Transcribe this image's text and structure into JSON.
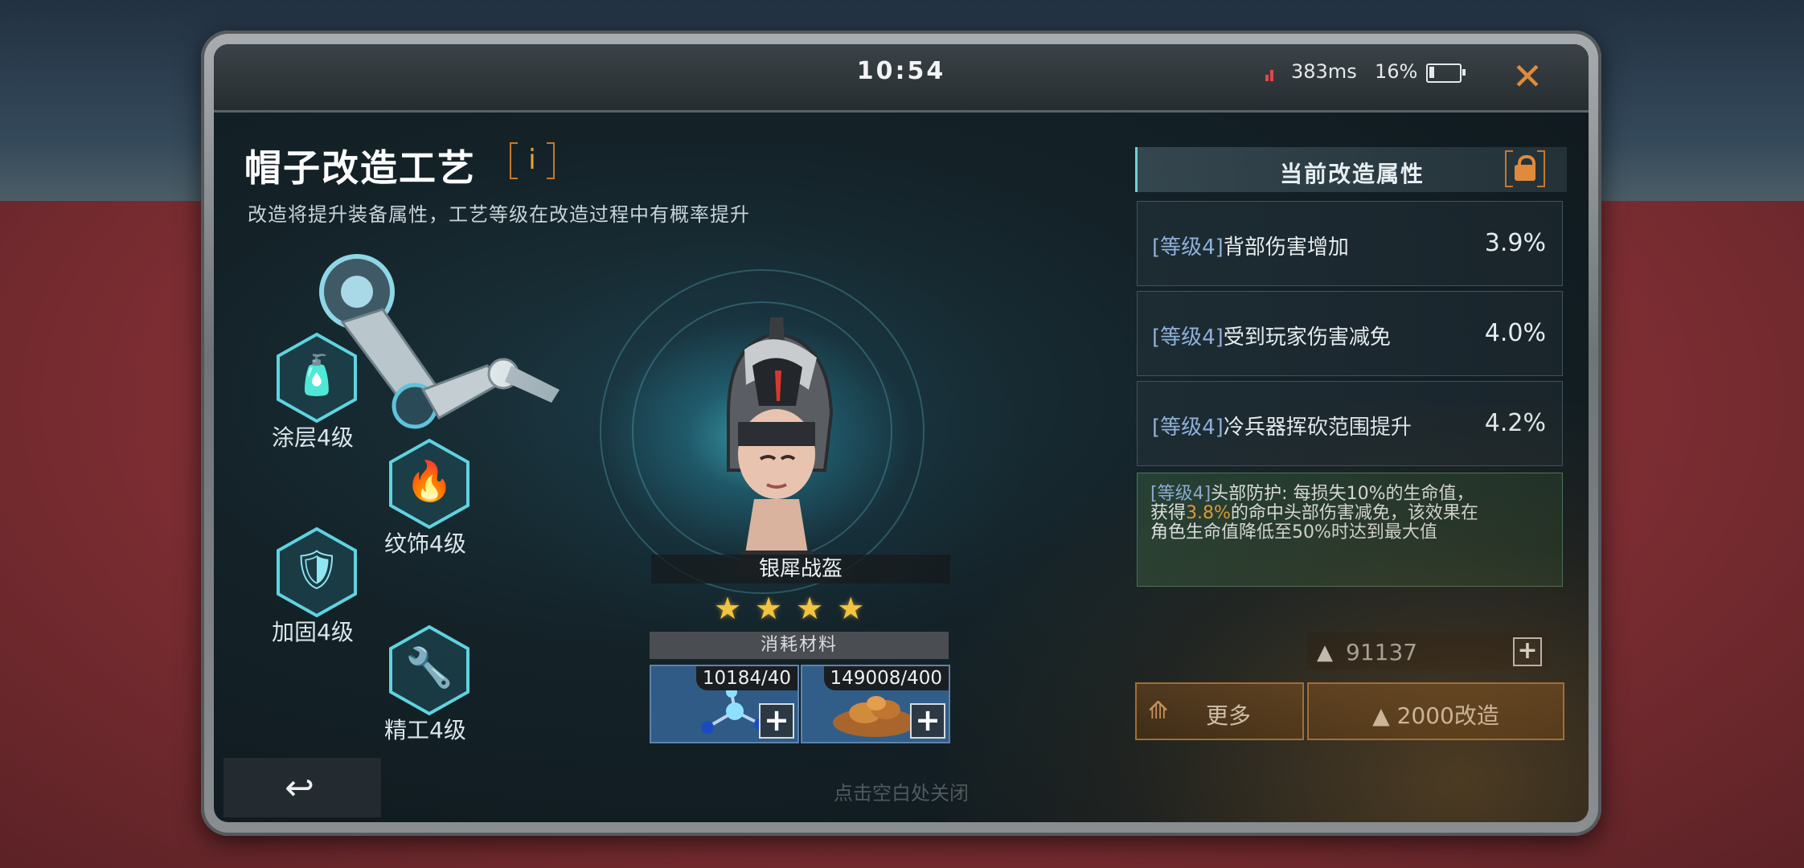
{
  "status_bar": {
    "time": "10:54",
    "ping": "383ms",
    "battery_percent": "16%",
    "battery_level": 0.16,
    "close_icon": "close-icon"
  },
  "header": {
    "title": "帽子改造工艺",
    "info_label": "i",
    "subtitle": "改造将提升装备属性，工艺等级在改造过程中有概率提升"
  },
  "crafts": [
    {
      "label": "涂层4级",
      "icon": "spray-can-icon"
    },
    {
      "label": "纹饰4级",
      "icon": "flame-emblem-icon"
    },
    {
      "label": "加固4级",
      "icon": "armor-plate-icon"
    },
    {
      "label": "精工4级",
      "icon": "precision-tool-icon"
    }
  ],
  "item": {
    "name": "银犀战盔",
    "stars": 4
  },
  "materials": {
    "header": "消耗材料",
    "slots": [
      {
        "count": "10184/40",
        "icon": "molecule-icon",
        "add": "+"
      },
      {
        "count": "149008/400",
        "icon": "copper-ore-icon",
        "add": "+"
      }
    ]
  },
  "attributes_panel": {
    "title": "当前改造属性",
    "rows": [
      {
        "level": "[等级4]",
        "name": "背部伤害增加",
        "value": "3.9%"
      },
      {
        "level": "[等级4]",
        "name": "受到玩家伤害减免",
        "value": "4.0%"
      },
      {
        "level": "[等级4]",
        "name": "冷兵器挥砍范围提升",
        "value": "4.2%"
      }
    ],
    "special": {
      "level": "[等级4]",
      "text_a": "头部防护: 每损失10%的生命值，获得",
      "highlight": "3.8%",
      "text_b": "的命中头部伤害减免，该效果在角色生命值降低至50%时达到最大值"
    }
  },
  "currency": {
    "amount": "91137",
    "add": "+"
  },
  "buttons": {
    "more": "更多",
    "modify": "2000改造"
  },
  "hint": "点击空白处关闭",
  "colors": {
    "accent_orange": "#e8a23c",
    "star_gold": "#f2c440",
    "cyan_glow": "#50e6f5"
  }
}
